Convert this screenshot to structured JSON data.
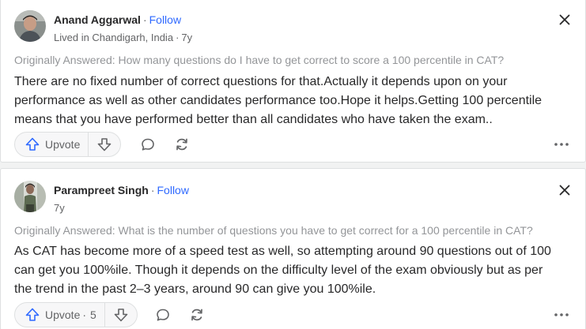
{
  "answers": [
    {
      "author": "Anand Aggarwal",
      "follow_label": "Follow",
      "credential": "Lived in Chandigarh, India",
      "age": "7y",
      "original_question": "Originally Answered: How many questions do I have to get correct to score a 100 percentile in CAT?",
      "body_lines": [
        "There are no fixed number of correct questions for that.Actually it depends upon on your",
        "performance as well as other candidates performance too.Hope it helps.Getting 100 percentile",
        "means that you have performed better than all candidates who have taken the exam.."
      ],
      "upvote_label": "Upvote",
      "upvote_count": ""
    },
    {
      "author": "Parampreet Singh",
      "follow_label": "Follow",
      "credential": "",
      "age": "7y",
      "original_question": "Originally Answered: What is the number of questions you have to get correct for a 100 percentile in CAT?",
      "body_lines": [
        "As CAT has become more of a speed test as well, so attempting around 90 questions out of 100",
        "can get you 100%ile. Though it depends on the difficulty level of the exam obviously but as per",
        "the trend in the past 2–3 years, around 90 can give you 100%ile."
      ],
      "upvote_label": "Upvote",
      "upvote_count": "5"
    }
  ],
  "separator": "·",
  "colors": {
    "link_blue": "#2e69ff",
    "text_primary": "#282829",
    "text_secondary": "#636466",
    "text_muted": "#939598"
  },
  "icons": [
    "upvote-arrow-icon",
    "downvote-arrow-icon",
    "comment-icon",
    "share-icon",
    "more-icon",
    "close-icon"
  ]
}
